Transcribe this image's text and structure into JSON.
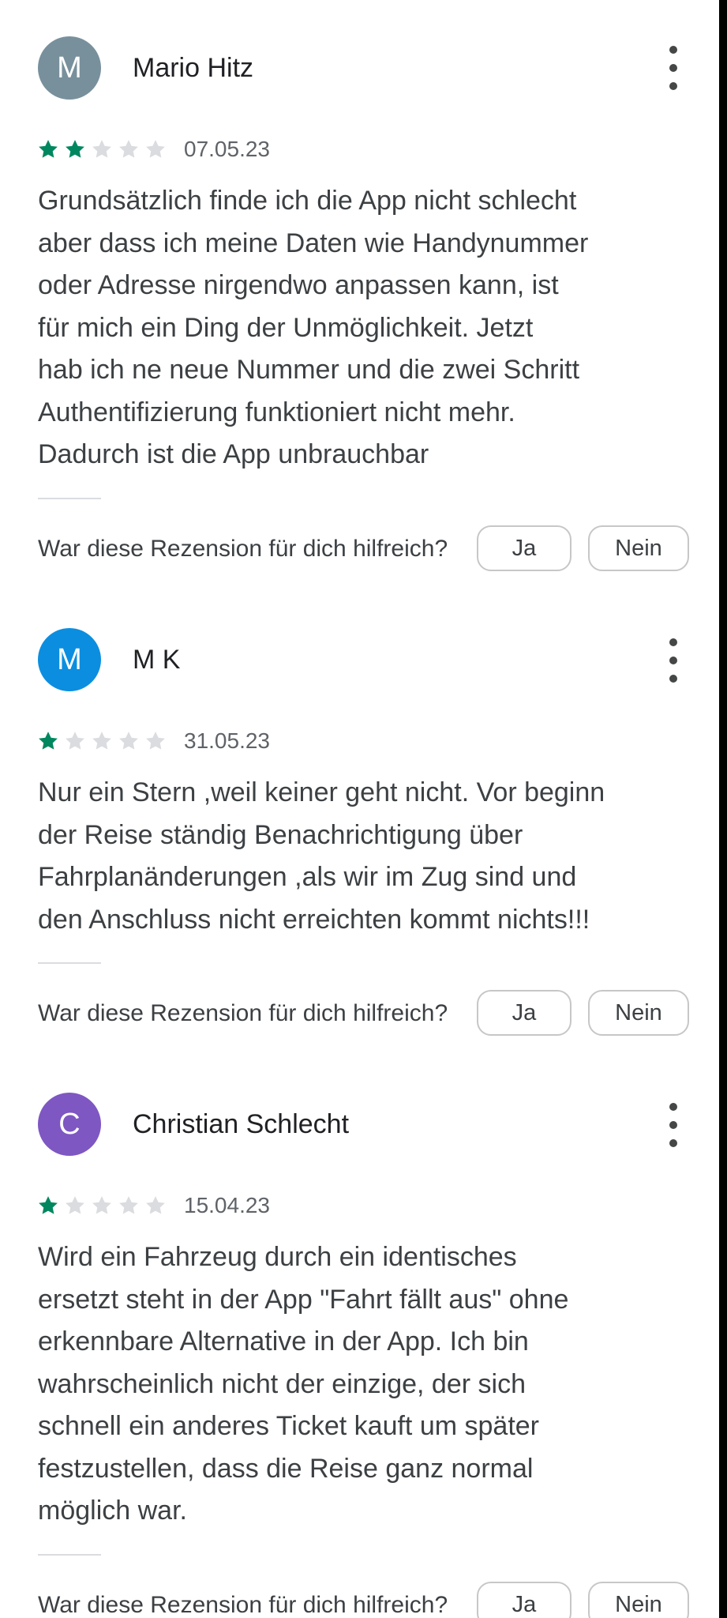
{
  "colors": {
    "star_filled": "#01875f",
    "star_empty": "#dadce0",
    "avatar_grey": "#78909c",
    "avatar_blue": "#0b8ee0",
    "avatar_purple": "#7e57c2"
  },
  "reviews": [
    {
      "initial": "M",
      "avatar_color": "#78909c",
      "author": "Mario Hitz",
      "rating": 2,
      "max_rating": 5,
      "date": "07.05.23",
      "text": "Grundsätzlich finde ich die App nicht schlecht\naber dass ich meine Daten wie Handynummer\noder Adresse nirgendwo anpassen kann, ist\nfür mich ein Ding der Unmöglichkeit. Jetzt\nhab ich ne neue Nummer und die zwei Schritt\nAuthentifizierung funktioniert nicht mehr.\nDadurch ist die App unbrauchbar",
      "helpful_question": "War diese Rezension für dich hilfreich?",
      "yes_label": "Ja",
      "no_label": "Nein"
    },
    {
      "initial": "M",
      "avatar_color": "#0b8ee0",
      "author": "M K",
      "rating": 1,
      "max_rating": 5,
      "date": "31.05.23",
      "text": "Nur ein Stern ,weil keiner geht nicht. Vor beginn\nder Reise ständig Benachrichtigung über\nFahrplanänderungen ,als wir im Zug sind und\nden Anschluss nicht erreichten kommt nichts!!!",
      "helpful_question": "War diese Rezension für dich hilfreich?",
      "yes_label": "Ja",
      "no_label": "Nein"
    },
    {
      "initial": "C",
      "avatar_color": "#7e57c2",
      "author": "Christian Schlecht",
      "rating": 1,
      "max_rating": 5,
      "date": "15.04.23",
      "text": "Wird ein Fahrzeug durch ein identisches\nersetzt steht in der App \"Fahrt fällt aus\" ohne\nerkennbare Alternative in der App. Ich bin\nwahrscheinlich nicht der einzige, der sich\nschnell ein anderes Ticket kauft um später\nfestzustellen, dass die Reise ganz normal\nmöglich war.",
      "helpful_question": "War diese Rezension für dich hilfreich?",
      "yes_label": "Ja",
      "no_label": "Nein"
    }
  ],
  "icons": {
    "more": "more-vert-icon",
    "star": "star-icon"
  }
}
